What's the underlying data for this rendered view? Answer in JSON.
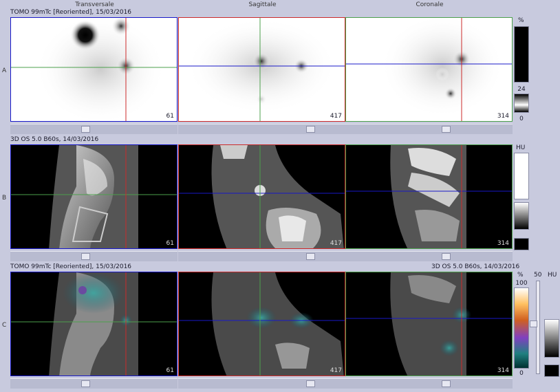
{
  "headers": {
    "transversale": "Transversale",
    "sagittale": "Sagittale",
    "coronale": "Coronale"
  },
  "row_labels": {
    "a": "A",
    "b": "B",
    "c": "C"
  },
  "series": {
    "spect": "TOMO 99mTc [Reoriented], 15/03/2016",
    "ct": "3D  OS  5.0  B60s, 14/03/2016",
    "fusion_left": "TOMO 99mTc [Reoriented], 15/03/2016",
    "fusion_right": "3D  OS  5.0  B60s, 14/03/2016"
  },
  "slices": {
    "transversale": "61",
    "sagittale": "417",
    "coronale": "314"
  },
  "scales": {
    "spect": {
      "unit": "%",
      "mid": "24",
      "low": "0"
    },
    "ct": {
      "unit": "HU"
    },
    "fusion": {
      "unit": "%",
      "high": "100",
      "low": "0",
      "window_label": "50",
      "ct_unit": "HU"
    }
  },
  "colors": {
    "background": "#c8cade",
    "transversale_frame": "#1818c8",
    "sagittale_frame": "#cc2a2a",
    "coronale_frame": "#4ca04c"
  }
}
